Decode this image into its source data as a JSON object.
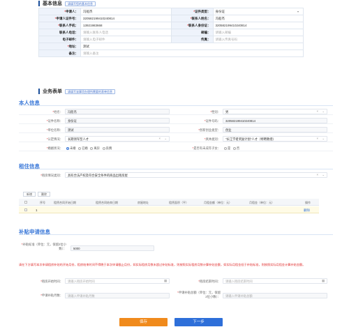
{
  "basic": {
    "title": "基本信息",
    "hint": "请填写您的基本信息",
    "applicant_label": "申请人：",
    "applicant_value": "冯船杰",
    "cert_type_label": "证件类型：",
    "cert_type_value": "身份证",
    "cert_no_label": "申请人证件号：",
    "cert_no_value": "320582199410240814",
    "contact_name_label": "联系人姓名：",
    "contact_name_value": "冯船杰",
    "contact_mobile_label": "联系人手机：",
    "contact_mobile_value": "13921983668",
    "contact_id_label": "联系人身份证：",
    "contact_id_value": "320582199410240814",
    "contact_phone_label": "联系人电话：",
    "contact_phone_ph": "请输入联系人电话",
    "postcode_label": "邮编：",
    "postcode_ph": "请输入邮编",
    "email_label": "电子邮件：",
    "email_ph": "请输入电子邮件",
    "fax_label": "传真：",
    "fax_ph": "请输入传真号码",
    "address_label": "地址：",
    "address_value": "测试",
    "remark_label": "备注：",
    "remark_ph": "请输入备注"
  },
  "business": {
    "title": "业务表单",
    "hint": "请填写该事项办理所需要的表单信息"
  },
  "personal": {
    "title": "本人信息",
    "name_label": "姓名：",
    "name_value": "冯船杰",
    "gender_label": "性别：",
    "gender_value": "男",
    "cert_name_label": "证件名称：",
    "cert_name_value": "身份证",
    "cert_no_label": "证件号码：",
    "cert_no_value": "320582199410240814",
    "unit_label": "单位名称：",
    "unit_value": "测试",
    "unit_type_label": "创新创业类型：",
    "unit_type_value": "创业",
    "talent_label": "认定情况：",
    "talent_value": "长期领军型人才",
    "category_label": "具体类别：",
    "category_value": "\"长江学者奖励计划\"人才（特聘教授）",
    "edu_label": "婚姻状况：",
    "edu_options": [
      "未婚",
      "已婚",
      "离异",
      "丧偶"
    ],
    "edu_selected": 0,
    "child_label": "是否有未成年子女：",
    "child_options": [
      "是",
      "否"
    ],
    "child_selected": -1
  },
  "rent": {
    "title": "租住信息",
    "house_label": "租房情况类别：",
    "house_value": "具有合法产权及符合安全条件的商品出租房屋",
    "add_label": "新增",
    "del_label": "删除",
    "columns": [
      "序号",
      "租赁合同开始日期",
      "租赁合同结束日期",
      "房屋地址",
      "租赁面积（平）",
      "月租金额（单位：元）",
      "月租金（单位：元）",
      "操作"
    ],
    "rows": [
      {
        "no": "1",
        "start": "",
        "end": "",
        "addr": "",
        "area": "",
        "rent1": "",
        "rent2": "",
        "op": "删除"
      }
    ]
  },
  "subsidy": {
    "title": "补贴申请信息",
    "amount_label": "补贴标准（单位：元，保留2位小数）：",
    "amount_value": "5000",
    "warning": "请在下方填写本次申请租房补贴的开始月份，租房结束时间不得晚于本次申请截止月份，如实际租房月数未超过补贴标准，则按照实际租房月数计算补贴金额，如实际月租金低于补贴标准，则按照实际月租金计算补贴金额。",
    "start_month_label": "租房开始时间：",
    "start_month_ph": "请输入租房开始时间",
    "end_month_label": "租房结束时间：",
    "end_month_ph": "请输入租房结束时间",
    "months_label": "申请补贴月数：",
    "months_ph": "请输入申请补贴月数",
    "total_label": "申请补贴总额（单位：元，保留2位小数）：",
    "total_ph": "请输入申请补贴总额"
  },
  "actions": {
    "save_label": "保存",
    "next_label": "下一步"
  },
  "colors": {
    "accent": "#3a78d8",
    "save": "#f08a1c",
    "next": "#2e6fd9",
    "warn": "#e03030"
  }
}
